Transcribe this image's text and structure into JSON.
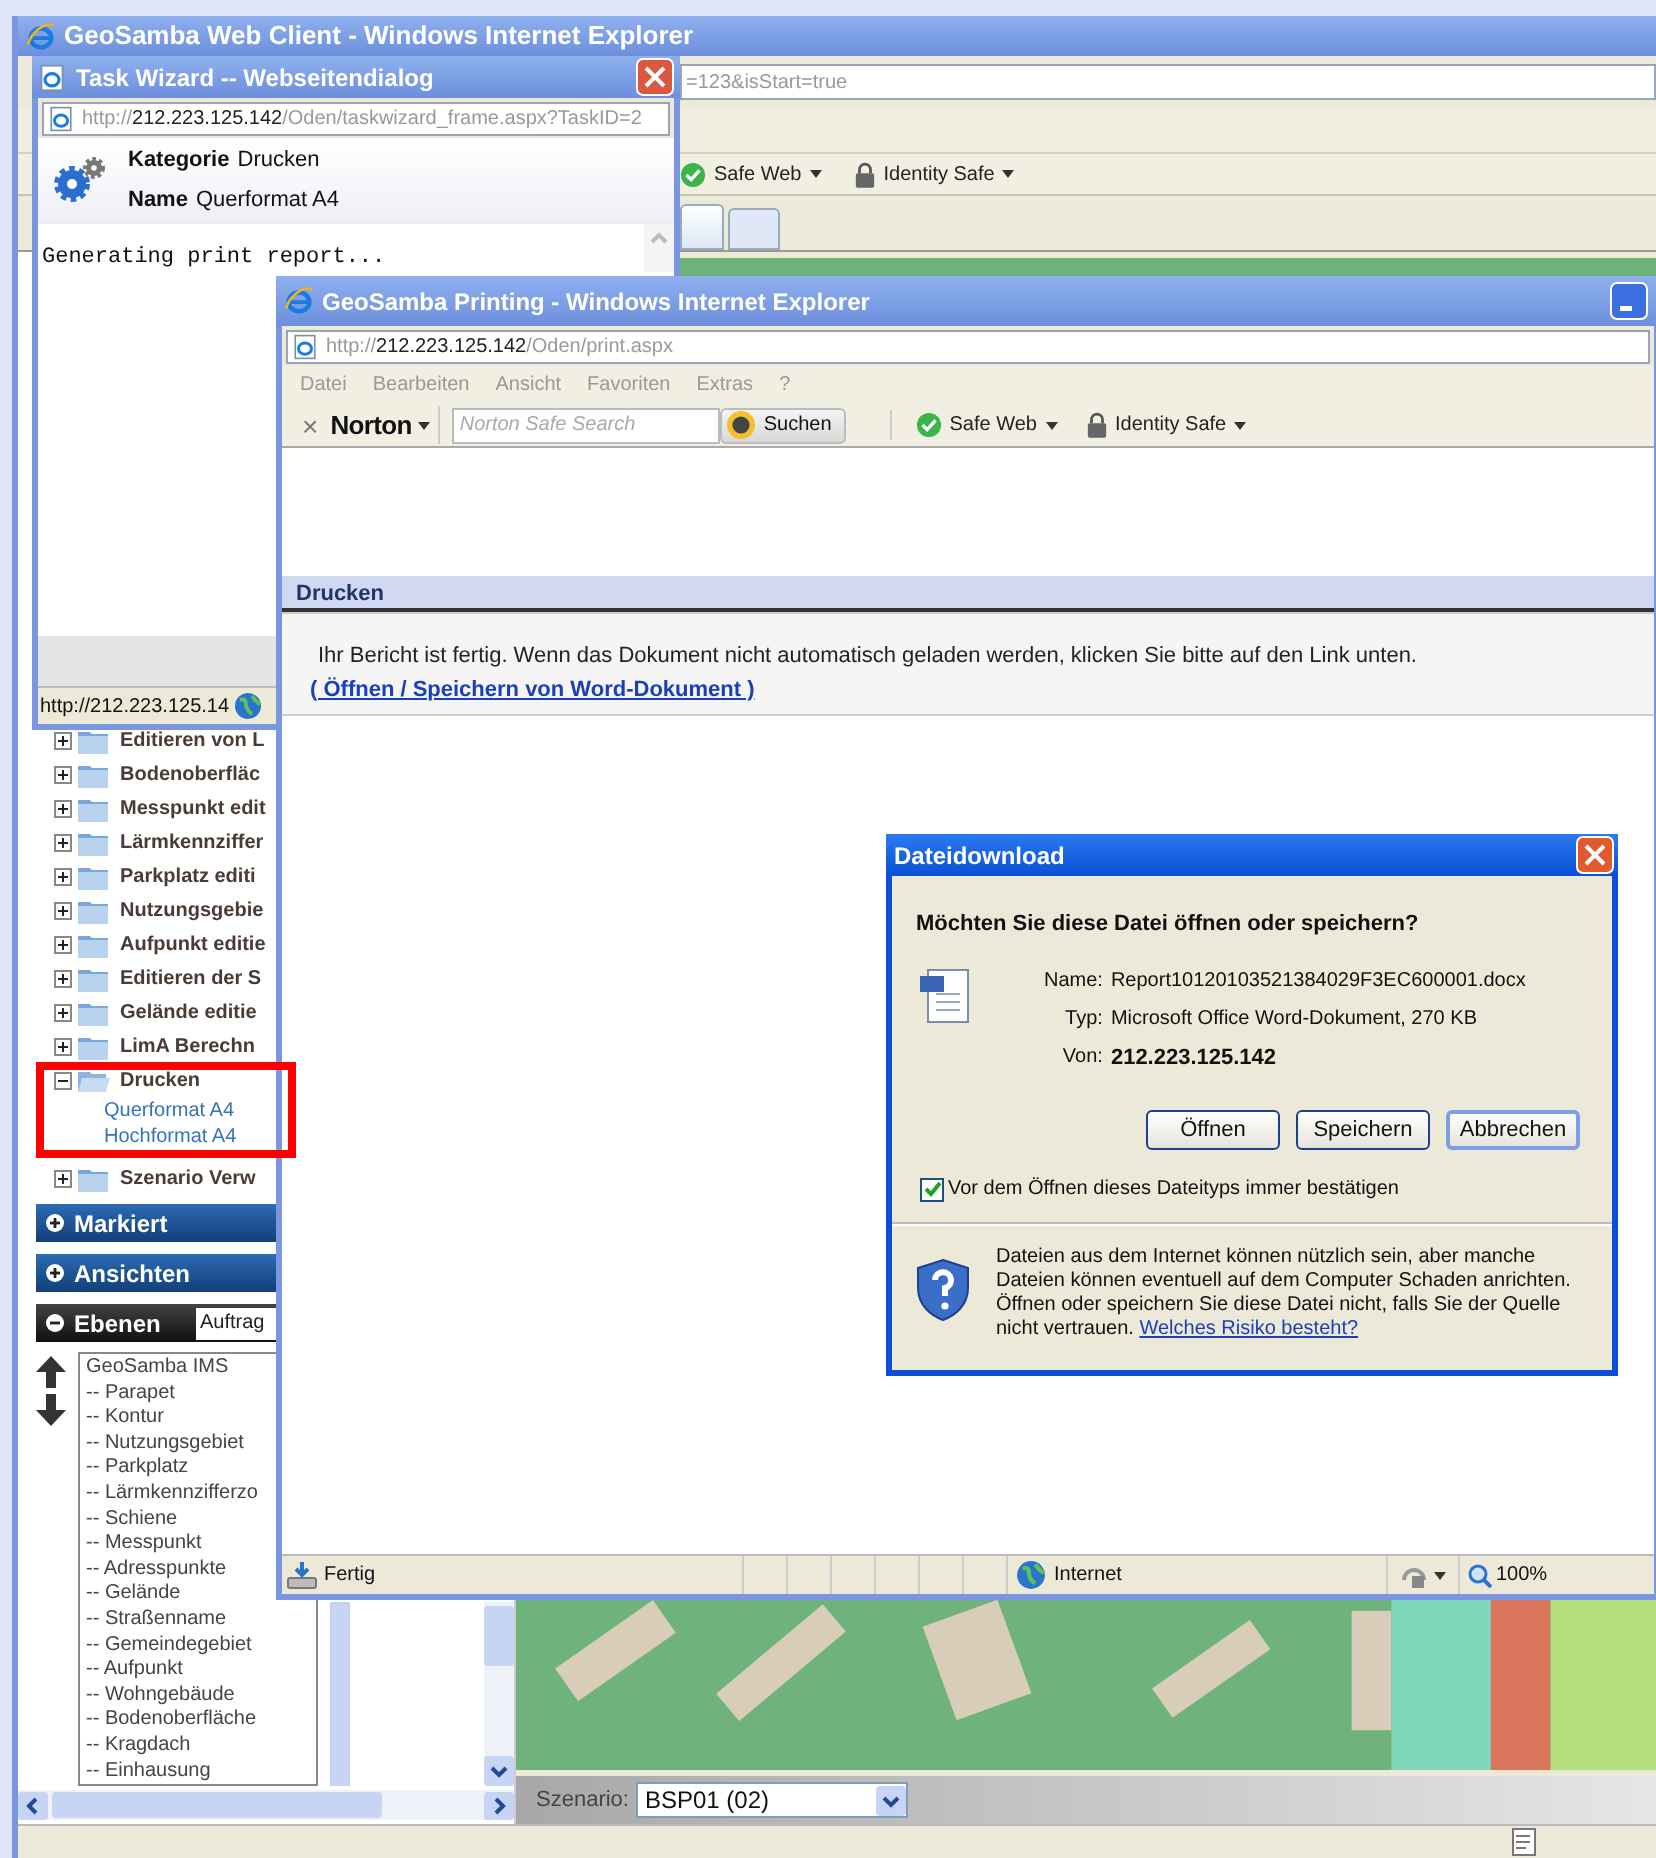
{
  "main_window": {
    "title": "GeoSamba Web Client - Windows Internet Explorer",
    "address": "=123&isStart=true",
    "toolbar": [
      {
        "label": "Safe Web",
        "kind": "safe-web"
      },
      {
        "label": "Identity Safe",
        "kind": "identity"
      }
    ],
    "tree": [
      {
        "label": "Editieren von L",
        "expanded": false
      },
      {
        "label": "Bodenoberfläc",
        "expanded": false
      },
      {
        "label": "Messpunkt edit",
        "expanded": false
      },
      {
        "label": "Lärmkennziffer",
        "expanded": false
      },
      {
        "label": "Parkplatz editi",
        "expanded": false
      },
      {
        "label": "Nutzungsgebie",
        "expanded": false
      },
      {
        "label": "Aufpunkt editie",
        "expanded": false
      },
      {
        "label": "Editieren der S",
        "expanded": false
      },
      {
        "label": "Gelände editie",
        "expanded": false
      },
      {
        "label": "LimA Berechn",
        "expanded": false
      },
      {
        "label": "Drucken",
        "expanded": true,
        "children": [
          {
            "label": "Querformat A4"
          },
          {
            "label": "Hochformat A4"
          }
        ]
      },
      {
        "label": "Szenario Verw",
        "expanded": false
      }
    ],
    "panels": [
      {
        "label": "Markiert",
        "expanded": false
      },
      {
        "label": "Ansichten",
        "expanded": false
      },
      {
        "label": "Ebenen",
        "expanded": true,
        "dropdown": "Auftrag"
      }
    ],
    "layers": [
      "GeoSamba IMS",
      "-- Parapet",
      "-- Kontur",
      "-- Nutzungsgebiet",
      "-- Parkplatz",
      "-- Lärmkennzifferzo",
      "-- Schiene",
      "-- Messpunkt",
      "-- Adresspunkte",
      "-- Gelände",
      "-- Straßenname",
      "-- Gemeindegebiet",
      "-- Aufpunkt",
      "-- Wohngebäude",
      "-- Bodenoberfläche",
      "-- Kragdach",
      "-- Einhausung"
    ],
    "scenario": {
      "label": "Szenario:",
      "value": "BSP01 (02)"
    }
  },
  "task_wizard": {
    "title": "Task Wizard -- Webseitendialog",
    "address": {
      "scheme": "http://",
      "host": "212.223.125.142",
      "path": "/Oden/taskwizard_frame.aspx?TaskID=2"
    },
    "fields": [
      {
        "label": "Kategorie",
        "value": "Drucken"
      },
      {
        "label": "Name",
        "value": "Querformat A4"
      }
    ],
    "log": "Generating print report...",
    "status": "http://212.223.125.14"
  },
  "print_window": {
    "title": "GeoSamba Printing - Windows Internet Explorer",
    "address": {
      "scheme": "http://",
      "host": "212.223.125.142",
      "path": "/Oden/print.aspx"
    },
    "menu": [
      "Datei",
      "Bearbeiten",
      "Ansicht",
      "Favoriten",
      "Extras",
      "?"
    ],
    "norton": {
      "close": "×",
      "brand": "Norton",
      "search_placeholder": "Norton Safe Search",
      "search_button": "Suchen",
      "items": [
        {
          "label": "Safe Web",
          "kind": "safe-web"
        },
        {
          "label": "Identity Safe",
          "kind": "identity"
        }
      ]
    },
    "section": "Drucken",
    "message": "Ihr Bericht ist fertig. Wenn das Dokument nicht automatisch geladen werden, klicken Sie bitte auf den Link unten.",
    "link": "( Öffnen / Speichern von Word-Dokument )",
    "status": "Fertig",
    "zone": "Internet",
    "zoom": "100%"
  },
  "download_dialog": {
    "title": "Dateidownload",
    "question": "Möchten Sie diese Datei öffnen oder speichern?",
    "details": [
      {
        "label": "Name:",
        "value": "Report10120103521384029F3EC600001.docx",
        "bold": false
      },
      {
        "label": "Typ:",
        "value": "Microsoft Office Word-Dokument, 270 KB",
        "bold": false
      },
      {
        "label": "Von:",
        "value": "212.223.125.142",
        "bold": true
      }
    ],
    "buttons": [
      {
        "label": "Öffnen",
        "default": false
      },
      {
        "label": "Speichern",
        "default": false
      },
      {
        "label": "Abbrechen",
        "default": true
      }
    ],
    "checkbox": {
      "label": "Vor dem Öffnen dieses Dateityps immer bestätigen",
      "checked": true
    },
    "warning": "Dateien aus dem Internet können nützlich sein, aber manche Dateien können eventuell auf dem Computer Schaden anrichten. Öffnen oder speichern Sie diese Datei nicht, falls Sie der Quelle nicht vertrauen.",
    "warning_link": "Welches Risiko besteht?"
  }
}
